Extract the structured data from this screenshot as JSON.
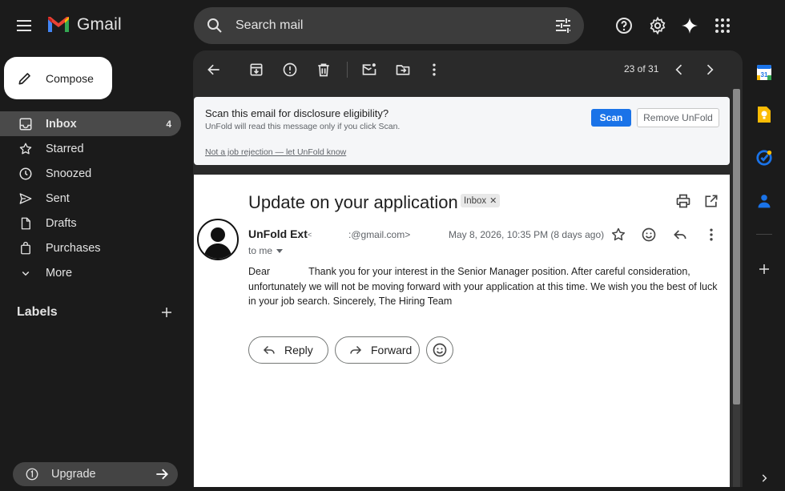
{
  "app": {
    "name": "Gmail",
    "colors": {
      "logo_red": "#ea4335",
      "logo_blue": "#4285f4",
      "logo_green": "#34a853",
      "logo_yellow": "#fbbc05",
      "scan_blue": "#1a73e8"
    }
  },
  "search": {
    "placeholder": "Search mail"
  },
  "header_icons": [
    "help-icon",
    "settings-icon",
    "gemini-icon",
    "apps-icon"
  ],
  "compose": {
    "label": "Compose"
  },
  "sidebar": {
    "items": [
      {
        "label": "Inbox",
        "count": "4",
        "icon": "inbox-icon",
        "active": true
      },
      {
        "label": "Starred",
        "icon": "star-icon"
      },
      {
        "label": "Snoozed",
        "icon": "clock-icon"
      },
      {
        "label": "Sent",
        "icon": "send-icon"
      },
      {
        "label": "Drafts",
        "icon": "draft-icon"
      },
      {
        "label": "Purchases",
        "icon": "bag-icon"
      },
      {
        "label": "More",
        "icon": "chevron-down-icon"
      }
    ],
    "labels_title": "Labels",
    "upgrade_label": "Upgrade"
  },
  "toolbar": {
    "icons": [
      "back-arrow-icon",
      "archive-icon",
      "report-spam-icon",
      "delete-icon",
      "mark-unread-icon",
      "move-to-icon",
      "more-vert-icon"
    ],
    "pager_text": "23 of 31"
  },
  "banner": {
    "title": "Scan this email for disclosure eligibility?",
    "subtitle": "UnFold will read this message only if you click Scan.",
    "scan_label": "Scan",
    "remove_label": "Remove UnFold",
    "link_text": "Not a job rejection — let UnFold know"
  },
  "email": {
    "subject": "Update on your application",
    "label_chip": "Inbox",
    "sender_name": "UnFold Ext",
    "sender_lt": "<",
    "sender_email": ":@gmail.com>",
    "date": "May 8, 2026, 10:35 PM (8 days ago)",
    "to": "to me",
    "body_greeting": "Dear",
    "body": "Thank you for your interest in the Senior Manager position. After careful consideration, unfortunately we will not be moving forward with your application at this time. We wish you the best of luck in your job search. Sincerely, The Hiring Team",
    "reply_label": "Reply",
    "forward_label": "Forward"
  },
  "side_rail": [
    "calendar-icon",
    "keep-icon",
    "tasks-icon",
    "contacts-icon",
    "add-icon",
    "expand-icon"
  ]
}
